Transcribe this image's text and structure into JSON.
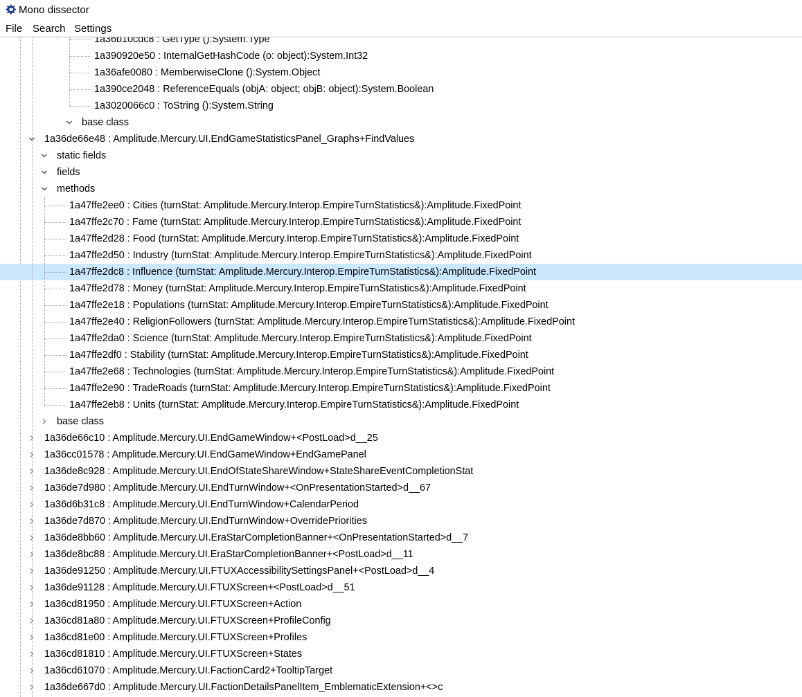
{
  "window": {
    "title": "Mono dissector",
    "icon": "cheat-engine-gear-icon"
  },
  "menu": {
    "file": "File",
    "search": "Search",
    "settings": "Settings"
  },
  "tree": {
    "rows": [
      {
        "text": "1a36b10cdc8 : GetType ():System.Type",
        "indent": 5,
        "toggle": "leaf"
      },
      {
        "text": "1a390920e50 : InternalGetHashCode (o: object):System.Int32",
        "indent": 5,
        "toggle": "leaf"
      },
      {
        "text": "1a36afe0080 : MemberwiseClone ():System.Object",
        "indent": 5,
        "toggle": "leaf"
      },
      {
        "text": "1a390ce2048 : ReferenceEquals (objA: object; objB: object):System.Boolean",
        "indent": 5,
        "toggle": "leaf"
      },
      {
        "text": "1a3020066c0 : ToString ():System.String",
        "indent": 5,
        "toggle": "leaf"
      },
      {
        "text": "base class",
        "indent": 4,
        "toggle": "expanded"
      },
      {
        "text": "1a36de66e48 : Amplitude.Mercury.UI.EndGameStatisticsPanel_Graphs+FindValues",
        "indent": 1,
        "toggle": "expanded"
      },
      {
        "text": "static fields",
        "indent": 2,
        "toggle": "expanded"
      },
      {
        "text": "fields",
        "indent": 2,
        "toggle": "expanded"
      },
      {
        "text": "methods",
        "indent": 2,
        "toggle": "expanded"
      },
      {
        "text": "1a47ffe2ee0 : Cities (turnStat: Amplitude.Mercury.Interop.EmpireTurnStatistics&):Amplitude.FixedPoint",
        "indent": 3,
        "toggle": "leaf"
      },
      {
        "text": "1a47ffe2c70 : Fame (turnStat: Amplitude.Mercury.Interop.EmpireTurnStatistics&):Amplitude.FixedPoint",
        "indent": 3,
        "toggle": "leaf"
      },
      {
        "text": "1a47ffe2d28 : Food (turnStat: Amplitude.Mercury.Interop.EmpireTurnStatistics&):Amplitude.FixedPoint",
        "indent": 3,
        "toggle": "leaf"
      },
      {
        "text": "1a47ffe2d50 : Industry (turnStat: Amplitude.Mercury.Interop.EmpireTurnStatistics&):Amplitude.FixedPoint",
        "indent": 3,
        "toggle": "leaf"
      },
      {
        "text": "1a47ffe2dc8 : Influence (turnStat: Amplitude.Mercury.Interop.EmpireTurnStatistics&):Amplitude.FixedPoint",
        "indent": 3,
        "toggle": "leaf",
        "selected": true
      },
      {
        "text": "1a47ffe2d78 : Money (turnStat: Amplitude.Mercury.Interop.EmpireTurnStatistics&):Amplitude.FixedPoint",
        "indent": 3,
        "toggle": "leaf"
      },
      {
        "text": "1a47ffe2e18 : Populations (turnStat: Amplitude.Mercury.Interop.EmpireTurnStatistics&):Amplitude.FixedPoint",
        "indent": 3,
        "toggle": "leaf"
      },
      {
        "text": "1a47ffe2e40 : ReligionFollowers (turnStat: Amplitude.Mercury.Interop.EmpireTurnStatistics&):Amplitude.FixedPoint",
        "indent": 3,
        "toggle": "leaf"
      },
      {
        "text": "1a47ffe2da0 : Science (turnStat: Amplitude.Mercury.Interop.EmpireTurnStatistics&):Amplitude.FixedPoint",
        "indent": 3,
        "toggle": "leaf"
      },
      {
        "text": "1a47ffe2df0 : Stability (turnStat: Amplitude.Mercury.Interop.EmpireTurnStatistics&):Amplitude.FixedPoint",
        "indent": 3,
        "toggle": "leaf"
      },
      {
        "text": "1a47ffe2e68 : Technologies (turnStat: Amplitude.Mercury.Interop.EmpireTurnStatistics&):Amplitude.FixedPoint",
        "indent": 3,
        "toggle": "leaf"
      },
      {
        "text": "1a47ffe2e90 : TradeRoads (turnStat: Amplitude.Mercury.Interop.EmpireTurnStatistics&):Amplitude.FixedPoint",
        "indent": 3,
        "toggle": "leaf"
      },
      {
        "text": "1a47ffe2eb8 : Units (turnStat: Amplitude.Mercury.Interop.EmpireTurnStatistics&):Amplitude.FixedPoint",
        "indent": 3,
        "toggle": "leaf"
      },
      {
        "text": "base class",
        "indent": 2,
        "toggle": "collapsed"
      },
      {
        "text": "1a36de66c10 : Amplitude.Mercury.UI.EndGameWindow+<PostLoad>d__25",
        "indent": 1,
        "toggle": "collapsed"
      },
      {
        "text": "1a36cc01578 : Amplitude.Mercury.UI.EndGameWindow+EndGamePanel",
        "indent": 1,
        "toggle": "collapsed"
      },
      {
        "text": "1a36de8c928 : Amplitude.Mercury.UI.EndOfStateShareWindow+StateShareEventCompletionStat",
        "indent": 1,
        "toggle": "collapsed"
      },
      {
        "text": "1a36de7d980 : Amplitude.Mercury.UI.EndTurnWindow+<OnPresentationStarted>d__67",
        "indent": 1,
        "toggle": "collapsed"
      },
      {
        "text": "1a36d6b31c8 : Amplitude.Mercury.UI.EndTurnWindow+CalendarPeriod",
        "indent": 1,
        "toggle": "collapsed"
      },
      {
        "text": "1a36de7d870 : Amplitude.Mercury.UI.EndTurnWindow+OverridePriorities",
        "indent": 1,
        "toggle": "collapsed"
      },
      {
        "text": "1a36de8bb60 : Amplitude.Mercury.UI.EraStarCompletionBanner+<OnPresentationStarted>d__7",
        "indent": 1,
        "toggle": "collapsed"
      },
      {
        "text": "1a36de8bc88 : Amplitude.Mercury.UI.EraStarCompletionBanner+<PostLoad>d__11",
        "indent": 1,
        "toggle": "collapsed"
      },
      {
        "text": "1a36de91250 : Amplitude.Mercury.UI.FTUXAccessibilitySettingsPanel+<PostLoad>d__4",
        "indent": 1,
        "toggle": "collapsed"
      },
      {
        "text": "1a36de91128 : Amplitude.Mercury.UI.FTUXScreen+<PostLoad>d__51",
        "indent": 1,
        "toggle": "collapsed"
      },
      {
        "text": "1a36cd81950 : Amplitude.Mercury.UI.FTUXScreen+Action",
        "indent": 1,
        "toggle": "collapsed"
      },
      {
        "text": "1a36cd81a80 : Amplitude.Mercury.UI.FTUXScreen+ProfileConfig",
        "indent": 1,
        "toggle": "collapsed"
      },
      {
        "text": "1a36cd81e00 : Amplitude.Mercury.UI.FTUXScreen+Profiles",
        "indent": 1,
        "toggle": "collapsed"
      },
      {
        "text": "1a36cd81810 : Amplitude.Mercury.UI.FTUXScreen+States",
        "indent": 1,
        "toggle": "collapsed"
      },
      {
        "text": "1a36cd61070 : Amplitude.Mercury.UI.FactionCard2+TooltipTarget",
        "indent": 1,
        "toggle": "collapsed"
      },
      {
        "text": "1a36de667d0 : Amplitude.Mercury.UI.FactionDetailsPanelItem_EmblematicExtension+<>c",
        "indent": 1,
        "toggle": "collapsed"
      }
    ]
  }
}
